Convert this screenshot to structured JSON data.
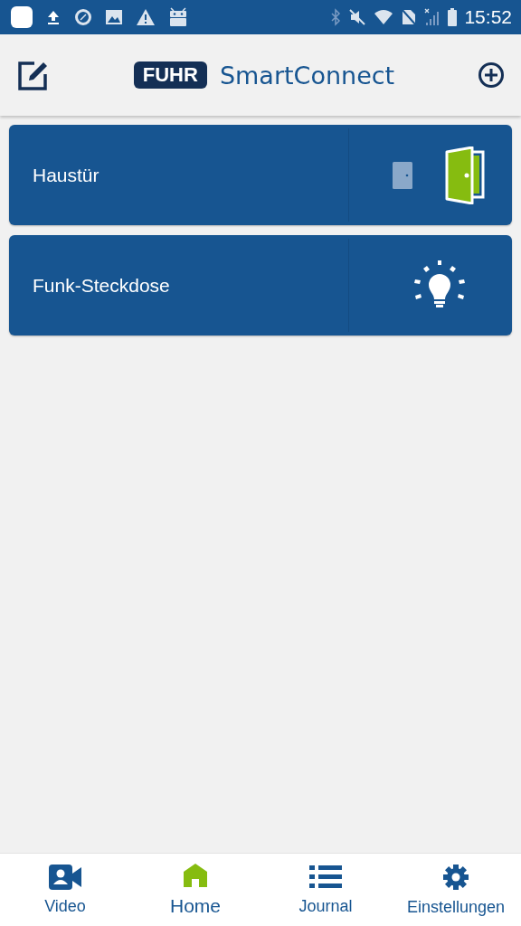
{
  "status_bar": {
    "time": "15:52"
  },
  "header": {
    "brand_badge": "FUHR",
    "brand_name": "SmartConnect"
  },
  "devices": [
    {
      "name": "Haustür",
      "kind": "door"
    },
    {
      "name": "Funk-Steckdose",
      "kind": "light"
    }
  ],
  "nav": [
    {
      "label": "Video",
      "kind": "video",
      "selected": false
    },
    {
      "label": "Home",
      "kind": "home",
      "selected": true
    },
    {
      "label": "Journal",
      "kind": "journal",
      "selected": false
    },
    {
      "label": "Einstellungen",
      "kind": "settings",
      "selected": false
    }
  ]
}
